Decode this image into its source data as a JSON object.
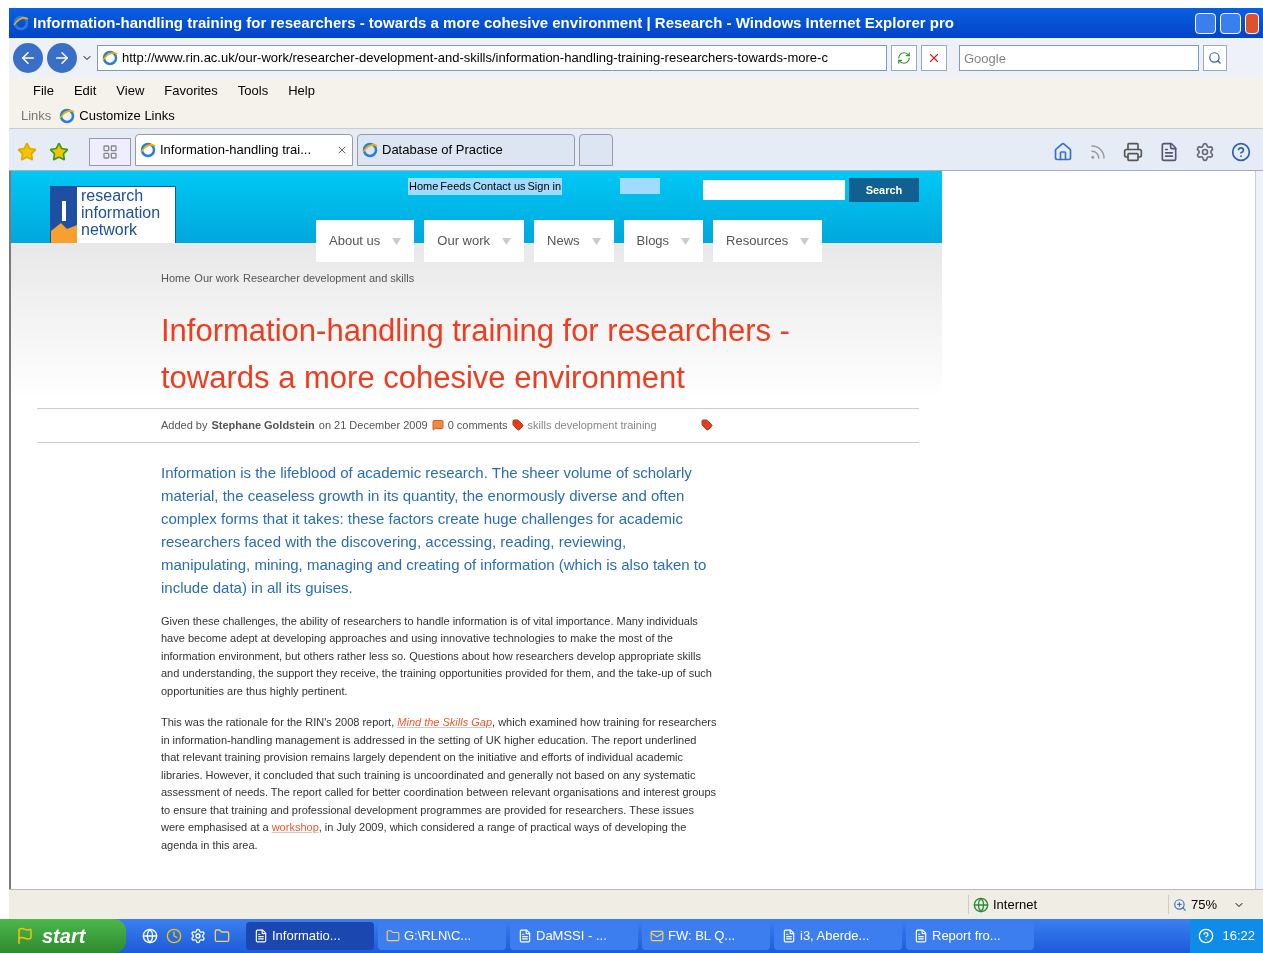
{
  "window": {
    "title": "Information-handling training for researchers - towards a more cohesive environment | Research  - Windows Internet Explorer pro"
  },
  "address_bar": {
    "url": "http://www.rin.ac.uk/our-work/researcher-development-and-skills/information-handling-training-researchers-towards-more-c",
    "search_placeholder": "Google"
  },
  "menu": [
    "File",
    "Edit",
    "View",
    "Favorites",
    "Tools",
    "Help"
  ],
  "links_bar": {
    "label": "Links",
    "items": [
      "Customize Links"
    ]
  },
  "tabs": [
    {
      "label": "Information-handling trai...",
      "selected": true
    },
    {
      "label": "Database of Practice",
      "selected": false
    }
  ],
  "page": {
    "util_links": [
      "Home",
      "Feeds",
      "Contact us",
      "Sign in"
    ],
    "search_button": "Search",
    "logo_lines": [
      "research",
      "information",
      "network"
    ],
    "nav": [
      "About us",
      "Our work",
      "News",
      "Blogs",
      "Resources"
    ],
    "breadcrumb": [
      "Home",
      "Our work",
      "Researcher development and skills"
    ],
    "title_lines": [
      "Information-handling training for researchers -",
      "towards a more cohesive environment"
    ],
    "byline": {
      "prefix": "Added by",
      "author": "Stephane Goldstein",
      "date": "on 21 December 2009",
      "comments": "0 comments",
      "tags": "skills development training"
    },
    "intro": "Information is the lifeblood of academic research. The sheer volume of scholarly material, the ceaseless growth in its quantity, the enormously diverse and often complex forms that it takes: these factors create huge challenges for academic researchers faced with the discovering, accessing, reading, reviewing, manipulating, mining, managing and creating of information (which is also taken to include data) in all its guises.",
    "paragraphs": [
      [
        {
          "kind": "text",
          "text": "Given these challenges, the ability of researchers to handle information is of vital importance. Many individuals have become adept at developing approaches and using innovative technologies to make the most of the information environment, but others rather less so. Questions about how researchers develop appropriate skills and understanding, the support they receive, the training opportunities provided for them, and the take-up of such opportunities are thus highly pertinent."
        }
      ],
      [
        {
          "kind": "text",
          "text": "This was the rationale for the RIN's 2008 report, "
        },
        {
          "kind": "link",
          "text": "*Mind the Skills Gap*"
        },
        {
          "kind": "text",
          "text": ", which examined how training for researchers in information-handling management is addressed in the setting of UK higher education. The report underlined that relevant training provision remains largely dependent on the initiative and efforts of individual academic libraries. However, it concluded that such training is uncoordinated and generally not based on any systematic assessment of needs. The report called for better coordination between relevant organisations and interest groups to ensure that training and professional development programmes are provided for researchers. These issues were emphasised at a "
        },
        {
          "kind": "link",
          "text": "workshop"
        },
        {
          "kind": "text",
          "text": ", in July 2009, which considered a range of practical ways of developing the agenda in this area."
        }
      ]
    ]
  },
  "status_bar": {
    "zone": "Internet",
    "zoom": "75%"
  },
  "taskbar": {
    "start": "start",
    "tasks": [
      {
        "label": "Informatio...",
        "selected": true
      },
      {
        "label": "G:\\RLN\\C...",
        "selected": false
      },
      {
        "label": "DaMSSI - ...",
        "selected": false
      },
      {
        "label": "FW: BL Q...",
        "selected": false
      },
      {
        "label": "i3, Aberde...",
        "selected": false
      },
      {
        "label": "Report fro...",
        "selected": false
      }
    ],
    "clock": "16:22"
  }
}
